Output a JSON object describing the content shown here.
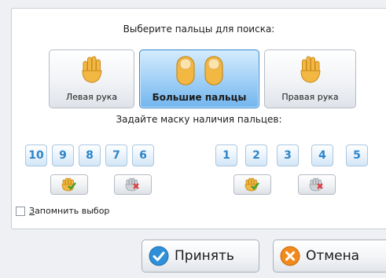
{
  "dialog": {
    "select_fingers_heading": "Выберите пальцы для поиска:",
    "hands": [
      {
        "label": "Левая рука",
        "selected": false
      },
      {
        "label": "Большие пальцы",
        "selected": true
      },
      {
        "label": "Правая рука",
        "selected": false
      }
    ],
    "mask_heading": "Задайте маску наличия пальцев:",
    "left_fingers": [
      "10",
      "9",
      "8",
      "7",
      "6"
    ],
    "right_fingers": [
      "1",
      "2",
      "3",
      "4",
      "5"
    ],
    "remember": {
      "label_accel": "З",
      "label_rest": "апомнить выбор",
      "checked": false
    },
    "accept_label": "Принять",
    "cancel_label": "Отмена"
  },
  "colors": {
    "accent_blue": "#3a87c8",
    "finger_digit": "#2d84c8",
    "accept_icon": "#2f8fd8",
    "cancel_icon": "#f08a1c",
    "hand_fill": "#f2b843"
  },
  "icons": {
    "hand_left": "hand-icon",
    "thumbs": "thumbs-icon",
    "hand_right": "hand-icon",
    "mask_set": "hand-check-icon",
    "mask_clear": "hand-cross-icon",
    "accept": "check-circle-icon",
    "cancel": "x-circle-icon"
  }
}
